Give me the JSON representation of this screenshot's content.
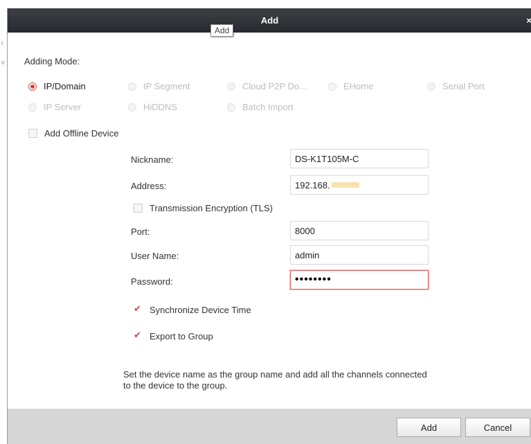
{
  "window": {
    "title": "Add",
    "close_label": "×",
    "tooltip": "Add"
  },
  "adding_mode": {
    "label": "Adding Mode:",
    "options": [
      {
        "label": "IP/Domain",
        "selected": true
      },
      {
        "label": "IP Segment",
        "selected": false
      },
      {
        "label": "Cloud P2P Do...",
        "selected": false
      },
      {
        "label": "EHome",
        "selected": false
      },
      {
        "label": "Serial Port",
        "selected": false
      },
      {
        "label": "IP Server",
        "selected": false
      },
      {
        "label": "HiDDNS",
        "selected": false
      },
      {
        "label": "Batch Import",
        "selected": false
      }
    ]
  },
  "offline_device": {
    "label": "Add Offline Device",
    "checked": false
  },
  "form": {
    "nickname": {
      "label": "Nickname:",
      "value": "DS-K1T105M-C"
    },
    "address": {
      "label": "Address:",
      "value": "192.168."
    },
    "tls": {
      "label": "Transmission Encryption (TLS)",
      "checked": false
    },
    "port": {
      "label": "Port:",
      "value": "8000"
    },
    "username": {
      "label": "User Name:",
      "value": "admin"
    },
    "password": {
      "label": "Password:",
      "value": "••••••••"
    },
    "sync_time": {
      "label": "Synchronize Device Time",
      "checked": true
    },
    "export_group": {
      "label": "Export to Group",
      "checked": true
    },
    "hint": "Set the device name as the group name and add all the channels connected to the device to the group."
  },
  "buttons": {
    "add": "Add",
    "cancel": "Cancel"
  },
  "colors": {
    "accent": "#e03c3c",
    "titlebar": "#2f3236",
    "footer": "#d6d6d6"
  }
}
